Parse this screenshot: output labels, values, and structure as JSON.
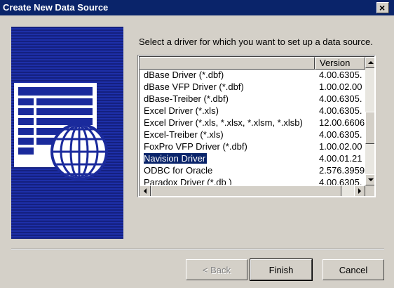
{
  "window": {
    "title": "Create New Data Source",
    "close_glyph": "×"
  },
  "prompt": "Select a driver for which you want to set up a data source.",
  "list": {
    "columns": [
      "",
      "Version"
    ],
    "rows": [
      {
        "name": "dBase Driver (*.dbf)",
        "version": "4.00.6305."
      },
      {
        "name": "dBase VFP Driver (*.dbf)",
        "version": "1.00.02.00"
      },
      {
        "name": "dBase-Treiber (*.dbf)",
        "version": "4.00.6305."
      },
      {
        "name": "Excel Driver (*.xls)",
        "version": "4.00.6305."
      },
      {
        "name": "Excel Driver (*.xls, *.xlsx, *.xlsm, *.xlsb)",
        "version": "12.00.6606"
      },
      {
        "name": "Excel-Treiber (*.xls)",
        "version": "4.00.6305."
      },
      {
        "name": "FoxPro VFP Driver (*.dbf)",
        "version": "1.00.02.00"
      },
      {
        "name": "Navision Driver",
        "version": "4.00.01.21"
      },
      {
        "name": "ODBC for Oracle",
        "version": "2.576.3959"
      },
      {
        "name": "Paradox Driver (*.db )",
        "version": "4.00.6305."
      }
    ],
    "selected_index": 7
  },
  "buttons": {
    "back": "< Back",
    "finish": "Finish",
    "cancel": "Cancel"
  },
  "colors": {
    "title_bar": "#0a246a",
    "panel_blue": "#1a2a9c",
    "selection": "#0a246a",
    "dialog_face": "#d4d0c8"
  },
  "icons": {
    "side_panel": "data-source-globe-icon"
  }
}
